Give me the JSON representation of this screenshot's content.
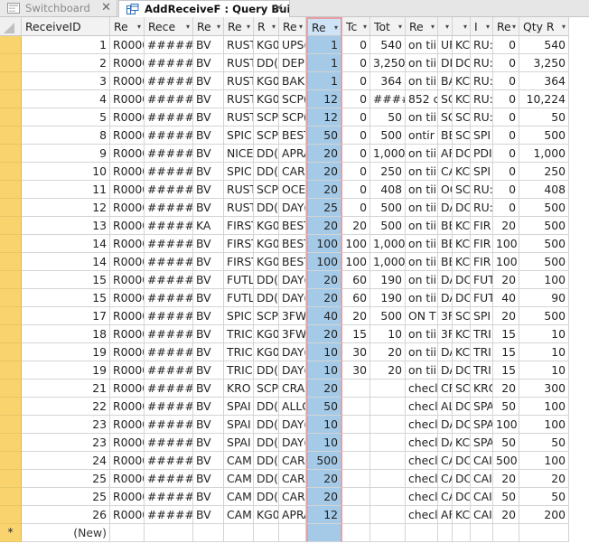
{
  "tabs": [
    {
      "label": "Switchboard",
      "icon": "form-icon",
      "active": false
    },
    {
      "label": "AddReceiveF : Query Builder",
      "icon": "query-icon",
      "active": true
    }
  ],
  "columns": [
    "ReceiveID",
    "Re",
    "Rece",
    "Re",
    "Re",
    "R",
    "Re",
    "Re",
    "Tc",
    "Tot",
    "Re",
    "",
    "",
    "I",
    "Re",
    "Qty R"
  ],
  "selected_column_index": 7,
  "rows": [
    [
      "1",
      "R0000",
      "########",
      "BV",
      "RUST",
      "KG0",
      "UPS(",
      "1",
      "0",
      "540",
      "on tii",
      "UF",
      "KC",
      "RU:",
      "0",
      "540"
    ],
    [
      "2",
      "R0000",
      "########",
      "BV",
      "RUST",
      "DD(",
      "DEPE",
      "1",
      "0",
      "3,250",
      "on tii",
      "DE",
      "DC",
      "RU:",
      "0",
      "3,250"
    ],
    [
      "3",
      "R0000",
      "########",
      "BV",
      "RUST",
      "KG0",
      "BAK$",
      "1",
      "0",
      "364",
      "on tii",
      "BA",
      "KC",
      "RU:",
      "0",
      "364"
    ],
    [
      "4",
      "R0000",
      "########",
      "BV",
      "RUST",
      "KG0",
      "SCP(",
      "12",
      "0",
      "####",
      "852 c",
      "SC",
      "KC",
      "RU:",
      "0",
      "10,224"
    ],
    [
      "5",
      "R0000",
      "########",
      "BV",
      "RUST",
      "SCP",
      "SCP(",
      "12",
      "0",
      "50",
      "on tii",
      "SC",
      "SC",
      "RU:",
      "0",
      "50"
    ],
    [
      "8",
      "R0000",
      "########",
      "BV",
      "SPIC",
      "SCP",
      "BEST",
      "50",
      "0",
      "500",
      "ontir",
      "BE",
      "SC",
      "SPI",
      "0",
      "500"
    ],
    [
      "9",
      "R0000",
      "########",
      "BV",
      "NICE",
      "DD(",
      "APRA",
      "20",
      "0",
      "1,000",
      "on tii",
      "AF",
      "DC",
      "PDI",
      "0",
      "1,000"
    ],
    [
      "10",
      "R0000",
      "########",
      "BV",
      "SPIC",
      "DD(",
      "CAR",
      "20",
      "0",
      "250",
      "on tii",
      "CA",
      "KC",
      "SPI",
      "0",
      "250"
    ],
    [
      "11",
      "R0000",
      "########",
      "BV",
      "RUST",
      "SCP",
      "OCE/",
      "20",
      "0",
      "408",
      "on tii",
      "OC",
      "SC",
      "RU:",
      "0",
      "408"
    ],
    [
      "12",
      "R0000",
      "########",
      "BV",
      "RUST",
      "DD(",
      "DAY(",
      "25",
      "0",
      "500",
      "on tii",
      "DA",
      "DC",
      "RU:",
      "0",
      "500"
    ],
    [
      "13",
      "R0000",
      "########",
      "KA",
      "FIRST",
      "KG0",
      "BEST",
      "20",
      "20",
      "500",
      "on tii",
      "BE",
      "KC",
      "FIR",
      "20",
      "500"
    ],
    [
      "14",
      "R0000",
      "########",
      "BV",
      "FIRST",
      "KG0",
      "BEST",
      "100",
      "100",
      "1,000",
      "on tii",
      "BE",
      "KC",
      "FIR",
      "100",
      "500"
    ],
    [
      "14",
      "R0000",
      "########",
      "BV",
      "FIRST",
      "KG0",
      "BEST",
      "100",
      "100",
      "1,000",
      "on tii",
      "BE",
      "KC",
      "FIR",
      "100",
      "500"
    ],
    [
      "15",
      "R0000",
      "########",
      "BV",
      "FUTL",
      "DD(",
      "DAY(",
      "20",
      "60",
      "190",
      "on tii",
      "DA",
      "DC",
      "FUT",
      "20",
      "100"
    ],
    [
      "15",
      "R0000",
      "########",
      "BV",
      "FUTL",
      "DD(",
      "DAY(",
      "20",
      "60",
      "190",
      "on tii",
      "DA",
      "DC",
      "FUT",
      "40",
      "90"
    ],
    [
      "17",
      "R0000",
      "########",
      "BV",
      "SPIC",
      "SCP",
      "3FW",
      "40",
      "20",
      "500",
      "ON T",
      "3F",
      "SC",
      "SPI",
      "20",
      "500"
    ],
    [
      "18",
      "R0000",
      "########",
      "BV",
      "TRIC",
      "KG0",
      "3FW",
      "20",
      "15",
      "10",
      "on tii",
      "3F",
      "KC",
      "TRI",
      "15",
      "10"
    ],
    [
      "19",
      "R0000",
      "########",
      "BV",
      "TRIC",
      "KG0",
      "DAY(",
      "10",
      "30",
      "20",
      "on tii",
      "DA",
      "KC",
      "TRI",
      "15",
      "10"
    ],
    [
      "19",
      "R0000",
      "########",
      "BV",
      "TRIC",
      "DD(",
      "DAY(",
      "10",
      "30",
      "20",
      "on tii",
      "DA",
      "DC",
      "TRI",
      "15",
      "10"
    ],
    [
      "21",
      "R0000",
      "########",
      "BV",
      "KRO",
      "SCP",
      "CRAI",
      "20",
      "",
      "",
      "checl",
      "CF",
      "SC",
      "KRO",
      "20",
      "300"
    ],
    [
      "22",
      "R0000",
      "########",
      "BV",
      "SPAI",
      "DD(",
      "ALLC",
      "50",
      "",
      "",
      "checl",
      "AL",
      "DC",
      "SPA",
      "50",
      "100"
    ],
    [
      "23",
      "R0000",
      "########",
      "BV",
      "SPAI",
      "DD(",
      "DAY(",
      "10",
      "",
      "",
      "checl",
      "DA",
      "DC",
      "SPA",
      "100",
      "100"
    ],
    [
      "23",
      "R0000",
      "########",
      "BV",
      "SPAI",
      "DD(",
      "DAY(",
      "10",
      "",
      "",
      "checl",
      "DA",
      "KC",
      "SPA",
      "50",
      "50"
    ],
    [
      "24",
      "R0000",
      "########",
      "BV",
      "CAM",
      "DD(",
      "CAR",
      "500",
      "",
      "",
      "checl",
      "CA",
      "DC",
      "CAI",
      "500",
      "100"
    ],
    [
      "25",
      "R0000",
      "########",
      "BV",
      "CAM",
      "DD(",
      "CAR",
      "20",
      "",
      "",
      "checl",
      "CA",
      "DC",
      "CAI",
      "20",
      "20"
    ],
    [
      "25",
      "R0000",
      "########",
      "BV",
      "CAM",
      "DD(",
      "CAR",
      "20",
      "",
      "",
      "checl",
      "CA",
      "DC",
      "CAI",
      "50",
      "50"
    ],
    [
      "26",
      "R0000",
      "########",
      "BV",
      "CAM",
      "KG0",
      "APRA",
      "12",
      "",
      "",
      "checl",
      "AF",
      "KC",
      "CAI",
      "20",
      "200"
    ]
  ],
  "new_row": {
    "marker": "*",
    "label": "(New)"
  },
  "colors": {
    "row_selector": "#f9d36e",
    "selected_column": "#a4cae8",
    "selected_border": "#e79ea2"
  }
}
